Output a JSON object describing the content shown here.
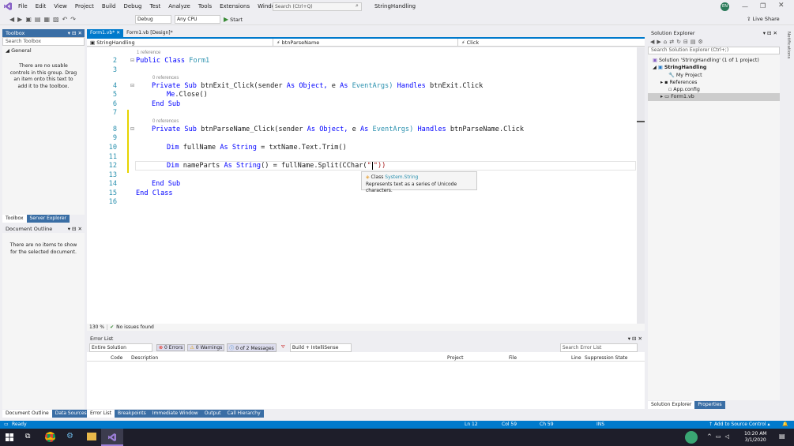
{
  "menu": [
    "File",
    "Edit",
    "View",
    "Project",
    "Build",
    "Debug",
    "Test",
    "Analyze",
    "Tools",
    "Extensions",
    "Window",
    "Help"
  ],
  "search": {
    "placeholder": "Search (Ctrl+Q)"
  },
  "project_name": "StringHandling",
  "avatar": "EN",
  "live_share": "Live Share",
  "toolbar": {
    "config": "Debug",
    "platform": "Any CPU",
    "start": "Start"
  },
  "toolbox": {
    "title": "Toolbox",
    "search": "Search Toolbox",
    "group": "General",
    "empty": "There are no usable controls in this group. Drag an item onto this text to add it to the toolbox.",
    "tabs": [
      "Toolbox",
      "Server Explorer"
    ]
  },
  "doc_outline": {
    "title": "Document Outline",
    "empty": "There are no items to show for the selected document."
  },
  "doc_tabs": [
    "Form1.vb*",
    "Form1.vb [Design]*"
  ],
  "nav": {
    "project": "StringHandling",
    "member": "btnParseName",
    "event": "Click"
  },
  "code": {
    "lines": [
      "2",
      "3",
      "4",
      "5",
      "6",
      "7",
      "8",
      "9",
      "10",
      "11",
      "12",
      "13",
      "14",
      "15",
      "16"
    ],
    "refs": [
      "1 reference",
      "0 references",
      "0 references"
    ],
    "l2a": "Public",
    "l2b": "Class",
    "l2c": "Form1",
    "l4a": "Private Sub",
    "l4b": "btnExit_Click(sender",
    "l4c": "As",
    "l4d": "Object,",
    "l4e": "e",
    "l4f": "As",
    "l4g": "EventArgs)",
    "l4h": "Handles",
    "l4i": "btnExit.Click",
    "l5a": "Me",
    ".l5b": "",
    "l5b": ".Close()",
    "l6": "End Sub",
    "l8a": "Private Sub",
    "l8b": "btnParseName_Click(sender",
    "l8c": "As",
    "l8d": "Object,",
    "l8e": "e",
    "l8f": "As",
    "l8g": "EventArgs)",
    "l8h": "Handles",
    "l8i": "btnParseName.Click",
    "l10a": "Dim",
    "l10b": "fullName",
    "l10c": "As",
    "l10d": "String",
    "l10e": "= txtName.Text.Trim()",
    "l12a": "Dim",
    "l12b": "nameParts",
    "l12c": "As",
    "l12d": "String",
    "l12e": "() = fullName.Split(CChar(",
    "l12f": "\"",
    "l12g": "\"))",
    "l14": "End Sub",
    "l15a": "End",
    "l15b": "Class"
  },
  "tooltip": {
    "kind": "Class",
    "name": "System.String",
    "desc": "Represents text as a series of Unicode characters."
  },
  "editor_status": {
    "zoom": "130 %",
    "issues": "No issues found"
  },
  "solution": {
    "title": "Solution Explorer",
    "search": "Search Solution Explorer (Ctrl+;)",
    "items": [
      "Solution 'StringHandling' (1 of 1 project)",
      "StringHandling",
      "My Project",
      "References",
      "App.config",
      "Form1.vb"
    ],
    "tabs": [
      "Solution Explorer",
      "Properties"
    ]
  },
  "notifications": "Notifications",
  "error_list": {
    "title": "Error List",
    "scope": "Entire Solution",
    "errors": "0 Errors",
    "warnings": "0 Warnings",
    "messages": "0 of 2 Messages",
    "build": "Build + IntelliSense",
    "search": "Search Error List",
    "columns": [
      "Code",
      "Description",
      "Project",
      "File",
      "Line",
      "Suppression State"
    ]
  },
  "bottom_tabs_left": [
    "Document Outline",
    "Data Sources"
  ],
  "bottom_tabs": [
    "Error List",
    "Breakpoints",
    "Immediate Window",
    "Output",
    "Call Hierarchy"
  ],
  "status": {
    "ready": "Ready",
    "ln": "Ln 12",
    "col": "Col 59",
    "ch": "Ch 59",
    "ins": "INS",
    "source": "Add to Source Control"
  },
  "clock": {
    "time": "10:20 AM",
    "date": "3/1/2020"
  }
}
